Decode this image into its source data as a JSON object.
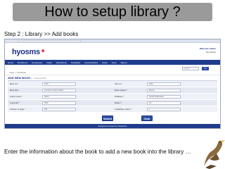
{
  "slide": {
    "title": "How to setup library ?",
    "step": "Step 2 : Library >> Add books",
    "caption": "Enter the information about the book to add a new book into the library …"
  },
  "app": {
    "url": "",
    "logo": "hyosms",
    "welcome": "Welcome Admin",
    "welcome_sub": "Sys Admin",
    "nav": [
      "Home",
      "Enrollment",
      "Employees",
      "Class",
      "Admissions",
      "Feedback",
      "Administration",
      "Exam",
      "Fees",
      "Report"
    ],
    "search_placeholder": "Search",
    "search_button": "Go",
    "breadcrumb": "Library >> Add Books",
    "form_title": "ADD NEW BOOK :",
    "form_subtitle": "Required fields *",
    "form": {
      "rows": [
        {
          "l_label": "Book no *",
          "l_value": "1023",
          "r_label": "Title no *",
          "r_value": "1022"
        },
        {
          "l_label": "Book title *",
          "l_value": "Computer Science Book",
          "r_label": "Book subject *",
          "r_value": "Rhyme"
        },
        {
          "l_label": "Author name *",
          "l_value": "Rahul",
          "r_label": "Publisher *",
          "r_value": "Saural publications"
        },
        {
          "l_label": "Copyright *",
          "l_value": "2010",
          "r_label": "Edition *",
          "r_value": "1st"
        },
        {
          "l_label": "Number of page *",
          "l_value": "230",
          "r_label": "Availability copies *",
          "r_value": "1"
        }
      ]
    },
    "submit_label": "Submit",
    "clear_label": "Clear",
    "footer": "Designed & Hosted by Raaspace"
  },
  "colors": {
    "title_bg": "#9a9a9a",
    "nav_bg": "#1f3c8a",
    "button_bg": "#2b4fa6",
    "logo_accent": "#d6231c"
  }
}
